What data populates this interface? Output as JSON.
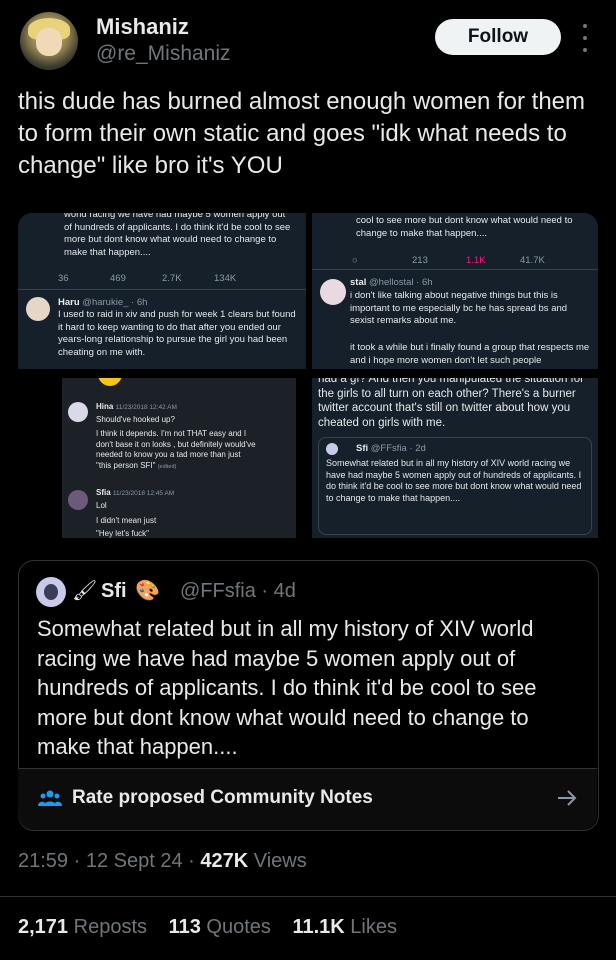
{
  "author": {
    "name": "Mishaniz",
    "handle": "@re_Mishaniz",
    "follow_label": "Follow"
  },
  "tweet": {
    "text": "this dude has burned almost enough women for them to form their own static and goes \"idk what needs to change\" like bro it's YOU"
  },
  "collage": {
    "p1": {
      "quoted_text": "wond racing we have had maybe 5 women apply out of hundreds of applicants. I do think it'd be cool to see more but dont know what would need to change to make that happen....",
      "stats": [
        "36",
        "469",
        "2.7K",
        "134K"
      ],
      "reply_name": "Haru",
      "reply_meta": "@harukie_ · 6h",
      "reply_text": "I used to raid in xiv and push for week 1 clears but found it hard to keep wanting to do that after you ended our years-long relationship to pursue the girl you had been cheating on me with."
    },
    "p2": {
      "quoted_text": "cool to see more but dont know what would need to change to make that happen....",
      "stats": [
        "213",
        "1.1K",
        "41.7K"
      ],
      "reply_name": "stal",
      "reply_meta": "@hellostal · 6h",
      "reply_text_1": "i don't like talking about negative things but this is important to me especially bc he has spread bs and sexist remarks about me.",
      "reply_text_2": "it took a while but i finally found a group that respects me and i hope more women don't let such people"
    },
    "p3": {
      "msg1_name": "Hina",
      "msg1_time": "11/23/2018 12:42 AM",
      "msg1_line1": "Should've hooked up?",
      "msg1_line2": "I think it depends. I'm not THAT easy and I don't base it on looks , but definitely would've needed to know you a tad more than just \"this person SFI\"",
      "msg1_edited": "(edited)",
      "msg2_name": "Sfia",
      "msg2_time": "11/23/2018 12:45 AM",
      "msg2_line1": "Lol",
      "msg2_line2": "I didn't mean just",
      "msg2_line3": "\"Hey let's fuck\""
    },
    "p4": {
      "text": "had a gf? And then you manipulated the situation for the girls to all turn on each other? There's a burner twitter account that's still on twitter about how you cheated on girls with me.",
      "quote_name": "Sfi",
      "quote_meta": "@FFsfia · 2d",
      "quote_text": "Somewhat related but in all my history of XIV world racing we have had maybe 5 women apply out of hundreds of applicants. I do think it'd be cool to see more but dont know what would need to change to make that happen...."
    }
  },
  "quoted_tweet": {
    "name": "Sfi",
    "handle_time": "@FFsfia · 4d",
    "text": "Somewhat related but in all my history of XIV world racing we have had maybe 5 women apply out of hundreds of applicants. I do think it'd be cool to see more but dont know what would need to change to make that happen....",
    "notes_label": "Rate proposed Community Notes"
  },
  "meta": {
    "time_date": "21:59 · 12 Sept 24 · ",
    "views_count": "427K",
    "views_label": " Views"
  },
  "stats": {
    "reposts_count": "2,171",
    "reposts_label": "Reposts",
    "quotes_count": "113",
    "quotes_label": "Quotes",
    "likes_count": "11.1K",
    "likes_label": "Likes"
  },
  "colors": {
    "background": "#000000",
    "text": "#e7e9ea",
    "muted": "#71767b",
    "follow_bg": "#eff3f4",
    "notes_accent": "#1d9bf0",
    "like_pink": "#f91880"
  }
}
